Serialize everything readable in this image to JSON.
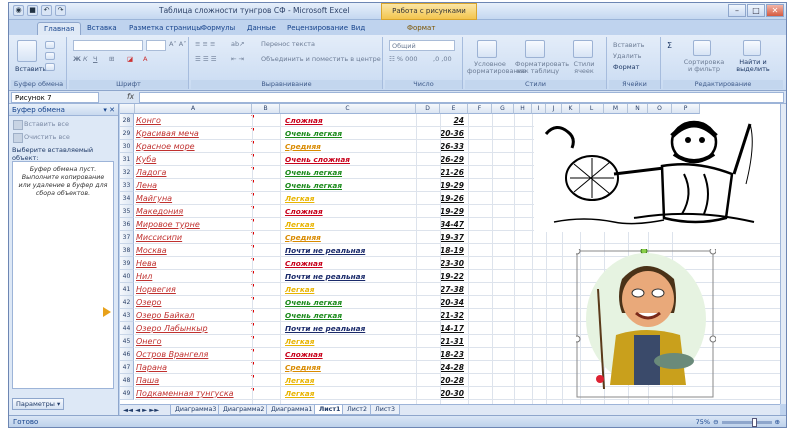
{
  "window": {
    "title": "Таблица сложности тунгров СФ - Microsoft Excel",
    "context_tab": "Работа с рисунками"
  },
  "tabs": [
    "Главная",
    "Вставка",
    "Разметка страницы",
    "Формулы",
    "Данные",
    "Рецензирование",
    "Вид",
    "Формат"
  ],
  "ribbon": {
    "groups": [
      "Буфер обмена",
      "Шрифт",
      "Выравнивание",
      "Число",
      "Стили",
      "Ячейки",
      "Редактирование"
    ],
    "paste": "Вставить",
    "wrap_text": "Перенос текста",
    "merge": "Объединить и поместить в центре",
    "number_format": "Общий",
    "styles": [
      "Условное форматирование",
      "Форматировать как таблицу",
      "Стили ячеек"
    ],
    "cells": [
      "Вставить",
      "Удалить",
      "Формат"
    ],
    "editing": [
      "Сортировка и фильтр",
      "Найти и выделить"
    ]
  },
  "formula_bar": {
    "name_box": "Рисунок 7",
    "fx": "fx"
  },
  "clipboard_pane": {
    "title": "Буфер обмена",
    "paste_all": "Вставить все",
    "clear_all": "Очистить все",
    "select_label": "Выберите вставляемый объект:",
    "empty_message": "Буфер обмена пуст. Выполните копирование или удаление в буфер для сбора объектов.",
    "options": "Параметры"
  },
  "columns": [
    "A",
    "B",
    "C",
    "D",
    "E",
    "F",
    "G",
    "H",
    "I",
    "J",
    "K",
    "L",
    "M",
    "N",
    "O",
    "P"
  ],
  "rows": [
    {
      "n": "28",
      "name": "Конго",
      "level": "Сложная",
      "color": "#c8001a",
      "score": "24"
    },
    {
      "n": "29",
      "name": "Красивая меча",
      "level": "Очень легкая",
      "color": "#1a8a1a",
      "score": "20-36"
    },
    {
      "n": "30",
      "name": "Красное море",
      "level": "Средняя",
      "color": "#d98a00",
      "score": "26-33"
    },
    {
      "n": "31",
      "name": "Куба",
      "level": "Очень сложная",
      "color": "#c8001a",
      "score": "26-29"
    },
    {
      "n": "32",
      "name": "Ладога",
      "level": "Очень легкая",
      "color": "#1a8a1a",
      "score": "21-26"
    },
    {
      "n": "33",
      "name": "Лена",
      "level": "Очень легкая",
      "color": "#1a8a1a",
      "score": "19-29"
    },
    {
      "n": "34",
      "name": "Майгуна",
      "level": "Легкая",
      "color": "#e8b400",
      "score": "19-26"
    },
    {
      "n": "35",
      "name": "Македония",
      "level": "Сложная",
      "color": "#c8001a",
      "score": "19-29"
    },
    {
      "n": "36",
      "name": "Мировое турне",
      "level": "Легкая",
      "color": "#e8b400",
      "score": "34-47"
    },
    {
      "n": "37",
      "name": "Миссисипи",
      "level": "Средняя",
      "color": "#d98a00",
      "score": "19-37"
    },
    {
      "n": "38",
      "name": "Москва",
      "level": "Почти не реальная",
      "color": "#1a2a6a",
      "score": "18-19"
    },
    {
      "n": "39",
      "name": "Нева",
      "level": "Сложная",
      "color": "#c8001a",
      "score": "23-30"
    },
    {
      "n": "40",
      "name": "Нил",
      "level": "Почти не реальная",
      "color": "#1a2a6a",
      "score": "19-22"
    },
    {
      "n": "41",
      "name": "Норвегия",
      "level": "Легкая",
      "color": "#e8b400",
      "score": "27-38"
    },
    {
      "n": "42",
      "name": "Озеро",
      "level": "Очень легкая",
      "color": "#1a8a1a",
      "score": "20-34"
    },
    {
      "n": "43",
      "name": "Озеро Байкал",
      "level": "Очень легкая",
      "color": "#1a8a1a",
      "score": "21-32"
    },
    {
      "n": "44",
      "name": "Озеро Лабынкыр",
      "level": "Почти не реальная",
      "color": "#1a2a6a",
      "score": "14-17"
    },
    {
      "n": "45",
      "name": "Онего",
      "level": "Легкая",
      "color": "#e8b400",
      "score": "21-31"
    },
    {
      "n": "46",
      "name": "Остров Врангеля",
      "level": "Сложная",
      "color": "#c8001a",
      "score": "18-23"
    },
    {
      "n": "47",
      "name": "Парана",
      "level": "Средняя",
      "color": "#d98a00",
      "score": "24-28"
    },
    {
      "n": "48",
      "name": "Паша",
      "level": "Легкая",
      "color": "#e8b400",
      "score": "20-28"
    },
    {
      "n": "49",
      "name": "Подкаменная тунгуска",
      "level": "Легкая",
      "color": "#e8b400",
      "score": "20-30"
    }
  ],
  "sheet_tabs": [
    "Диаграмма3",
    "Диаграмма2",
    "Диаграмма1",
    "Лист1",
    "Лист2",
    "Лист3"
  ],
  "active_sheet": "Лист1",
  "status": {
    "ready": "Готово",
    "zoom": "75%"
  }
}
